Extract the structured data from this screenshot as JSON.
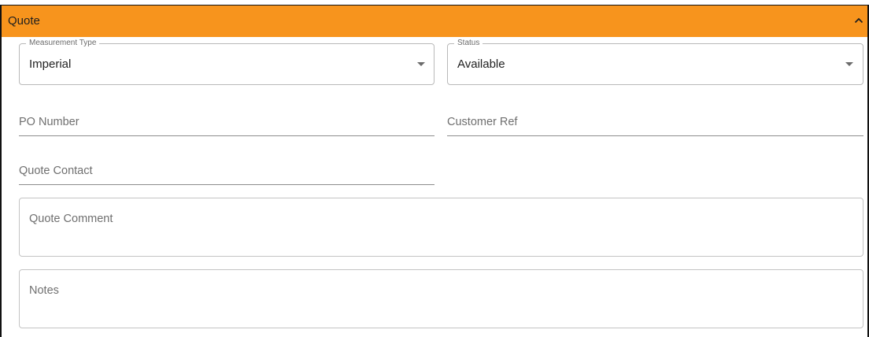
{
  "panel": {
    "title": "Quote",
    "accent_color": "#f7941d",
    "collapse_icon": "chevron-up-icon"
  },
  "fields": {
    "measurement_type": {
      "label": "Measurement Type",
      "value": "Imperial"
    },
    "status": {
      "label": "Status",
      "value": "Available"
    },
    "po_number": {
      "placeholder": "PO Number"
    },
    "customer_ref": {
      "placeholder": "Customer Ref"
    },
    "quote_contact": {
      "placeholder": "Quote Contact"
    },
    "quote_comment": {
      "placeholder": "Quote Comment"
    },
    "notes": {
      "placeholder": "Notes"
    }
  }
}
